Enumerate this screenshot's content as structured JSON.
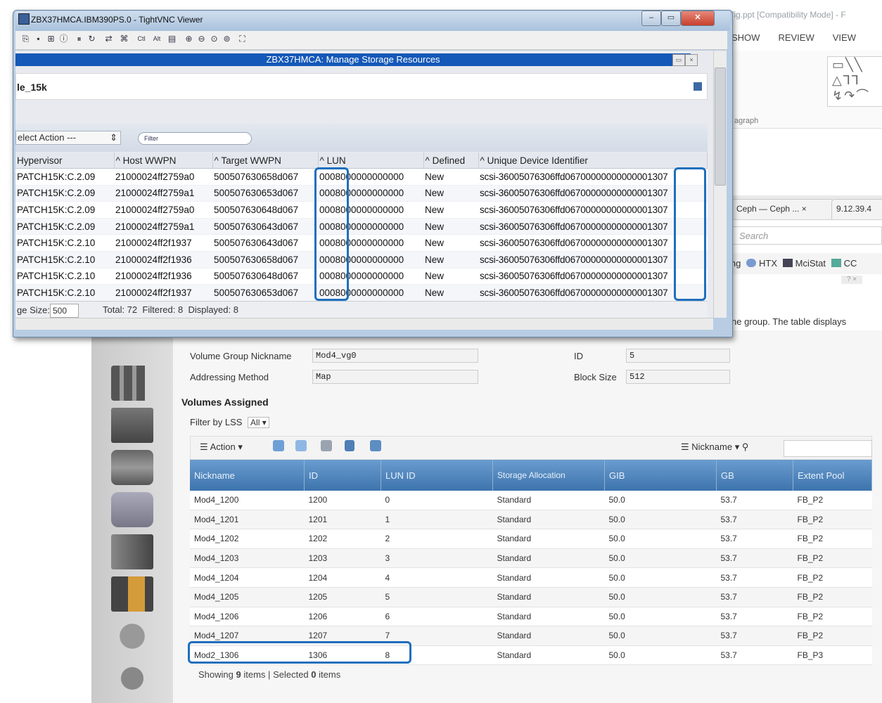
{
  "powerpoint": {
    "title": "fig.ppt [Compatibility Mode] - F",
    "tabs": [
      "SHOW",
      "REVIEW",
      "VIEW"
    ],
    "paragraph_label": "agraph"
  },
  "browser": {
    "tabs": [
      "Ceph — Ceph ...",
      "9.12.39.4"
    ],
    "search_placeholder": "Search",
    "bookmarks": [
      "ing",
      "HTX",
      "MciStat",
      "CC"
    ],
    "description": "ne group. The table displays"
  },
  "vnc": {
    "title": "ZBX37HMCA.IBM390PS.0 - TightVNC Viewer",
    "inner_title": "ZBX37HMCA: Manage Storage Resources",
    "panel_title": "le_15k",
    "action_select": "elect Action ---",
    "filter_placeholder": "Filter",
    "columns": [
      "Hypervisor",
      "Host WWPN",
      "Target WWPN",
      "LUN",
      "Defined",
      "Unique Device Identifier"
    ],
    "rows": [
      [
        "PATCH15K:C.2.09",
        "21000024ff2759a0",
        "500507630658d067",
        "0008000000000000",
        "New",
        "scsi-36005076306ffd06700000000000001307"
      ],
      [
        "PATCH15K:C.2.09",
        "21000024ff2759a1",
        "500507630653d067",
        "0008000000000000",
        "New",
        "scsi-36005076306ffd06700000000000001307"
      ],
      [
        "PATCH15K:C.2.09",
        "21000024ff2759a0",
        "500507630648d067",
        "0008000000000000",
        "New",
        "scsi-36005076306ffd06700000000000001307"
      ],
      [
        "PATCH15K:C.2.09",
        "21000024ff2759a1",
        "500507630643d067",
        "0008000000000000",
        "New",
        "scsi-36005076306ffd06700000000000001307"
      ],
      [
        "PATCH15K:C.2.10",
        "21000024ff2f1937",
        "500507630643d067",
        "0008000000000000",
        "New",
        "scsi-36005076306ffd06700000000000001307"
      ],
      [
        "PATCH15K:C.2.10",
        "21000024ff2f1936",
        "500507630658d067",
        "0008000000000000",
        "New",
        "scsi-36005076306ffd06700000000000001307"
      ],
      [
        "PATCH15K:C.2.10",
        "21000024ff2f1936",
        "500507630648d067",
        "0008000000000000",
        "New",
        "scsi-36005076306ffd06700000000000001307"
      ],
      [
        "PATCH15K:C.2.10",
        "21000024ff2f1937",
        "500507630653d067",
        "0008000000000000",
        "New",
        "scsi-36005076306ffd06700000000000001307"
      ]
    ],
    "status": {
      "page_size_label": "ge Size:",
      "page_size": "500",
      "total": "Total: 72",
      "filtered": "Filtered: 8",
      "displayed": "Displayed: 8"
    }
  },
  "volume_group": {
    "nickname_label": "Volume Group Nickname",
    "nickname": "Mod4_vg0",
    "id_label": "ID",
    "id": "5",
    "addressing_label": "Addressing Method",
    "addressing": "Map",
    "block_size_label": "Block Size",
    "block_size": "512",
    "section_title": "Volumes Assigned",
    "filter_label": "Filter by LSS",
    "filter_value": "All",
    "toolbar": {
      "action": "Action",
      "nickname": "Nickname"
    },
    "columns": [
      "Nickname",
      "ID",
      "LUN ID",
      "Storage Allocation",
      "GIB",
      "GB",
      "Extent Pool"
    ],
    "rows": [
      [
        "Mod4_1200",
        "1200",
        "0",
        "Standard",
        "50.0",
        "53.7",
        "FB_P2"
      ],
      [
        "Mod4_1201",
        "1201",
        "1",
        "Standard",
        "50.0",
        "53.7",
        "FB_P2"
      ],
      [
        "Mod4_1202",
        "1202",
        "2",
        "Standard",
        "50.0",
        "53.7",
        "FB_P2"
      ],
      [
        "Mod4_1203",
        "1203",
        "3",
        "Standard",
        "50.0",
        "53.7",
        "FB_P2"
      ],
      [
        "Mod4_1204",
        "1204",
        "4",
        "Standard",
        "50.0",
        "53.7",
        "FB_P2"
      ],
      [
        "Mod4_1205",
        "1205",
        "5",
        "Standard",
        "50.0",
        "53.7",
        "FB_P2"
      ],
      [
        "Mod4_1206",
        "1206",
        "6",
        "Standard",
        "50.0",
        "53.7",
        "FB_P2"
      ],
      [
        "Mod4_1207",
        "1207",
        "7",
        "Standard",
        "50.0",
        "53.7",
        "FB_P2"
      ],
      [
        "Mod2_1306",
        "1306",
        "8",
        "Standard",
        "50.0",
        "53.7",
        "FB_P3"
      ]
    ],
    "footer": {
      "showing": "Showing",
      "count": "9",
      "items": "items",
      "sep": "|",
      "selected": "Selected",
      "selected_count": "0",
      "selected_items": "items"
    }
  },
  "colors": {
    "highlight": "#1f6fbd",
    "title_bar": "#1458b8",
    "table_header": "#3d74ad"
  }
}
